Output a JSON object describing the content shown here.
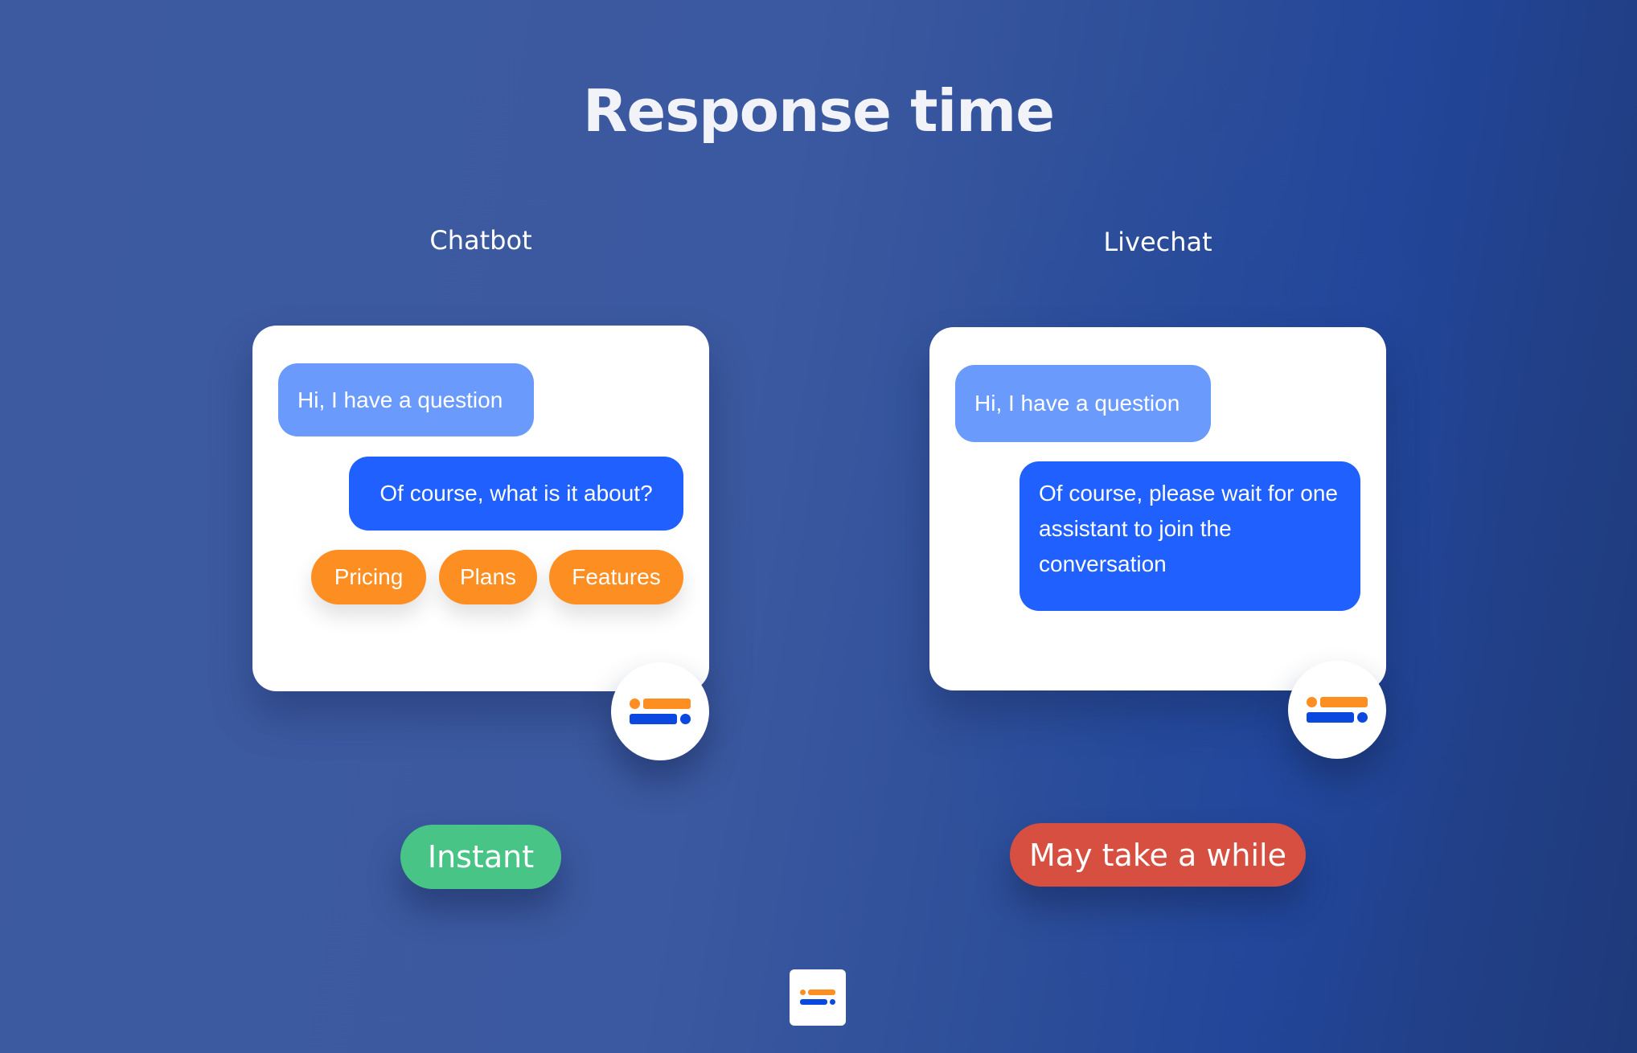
{
  "title": "Response time",
  "colors": {
    "user_bubble": "#6b9afd",
    "bot_bubble": "#1f60ff",
    "chip": "#fd8e22",
    "instant": "#47c486",
    "slow": "#d64f40",
    "logo_orange": "#fd8e22",
    "logo_blue": "#0a48e0"
  },
  "chatbot": {
    "heading": "Chatbot",
    "user_message": "Hi, I have a question",
    "bot_message": "Of course, what is it about?",
    "quick_replies": [
      "Pricing",
      "Plans",
      "Features"
    ],
    "avatar_icon": "brand-logo-icon",
    "badge": "Instant"
  },
  "livechat": {
    "heading": "Livechat",
    "user_message": "Hi, I have a question",
    "bot_message": "Of course, please wait for one assistant to join the conversation",
    "avatar_icon": "brand-logo-icon",
    "badge": "May take a while"
  },
  "footer": {
    "logo_icon": "brand-logo-icon"
  }
}
